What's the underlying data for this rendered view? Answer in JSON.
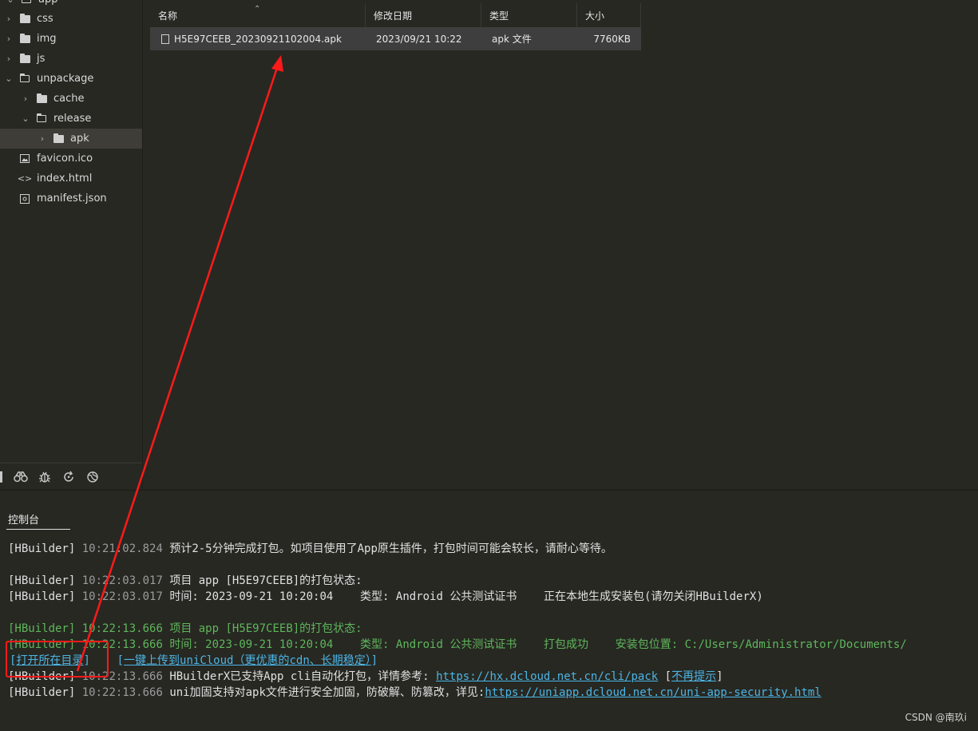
{
  "sidebar": {
    "items": [
      {
        "label": "app",
        "kind": "folder-open",
        "depth": 0
      },
      {
        "label": "css",
        "kind": "folder",
        "depth": 0
      },
      {
        "label": "img",
        "kind": "folder",
        "depth": 0
      },
      {
        "label": "js",
        "kind": "folder",
        "depth": 0
      },
      {
        "label": "unpackage",
        "kind": "folder-open",
        "depth": 0
      },
      {
        "label": "cache",
        "kind": "folder",
        "depth": 1
      },
      {
        "label": "release",
        "kind": "folder-open",
        "depth": 1
      },
      {
        "label": "apk",
        "kind": "folder",
        "depth": 2
      },
      {
        "label": "favicon.ico",
        "kind": "image-file",
        "depth": 0
      },
      {
        "label": "index.html",
        "kind": "code-file",
        "depth": 0
      },
      {
        "label": "manifest.json",
        "kind": "json-file",
        "depth": 0
      }
    ],
    "selected": "apk"
  },
  "explorer": {
    "columns": {
      "name": "名称",
      "date": "修改日期",
      "type": "类型",
      "size": "大小"
    },
    "file": {
      "name": "H5E97CEEB_20230921102004.apk",
      "date": "2023/09/21 10:22",
      "type": "apk 文件",
      "size": "7760KB"
    }
  },
  "toolbar_icons": [
    "binoculars-icon",
    "bug-icon",
    "refresh-icon",
    "globe-icon"
  ],
  "console": {
    "tab_label": "控制台",
    "lines": [
      {
        "tag": "[HBuilder]",
        "time": "10:21:02.824",
        "text": "预计2-5分钟完成打包。如项目使用了App原生插件，打包时间可能会较长，请耐心等待。"
      },
      {
        "tag": "[HBuilder]",
        "time": "10:22:03.017",
        "text": "项目 app [H5E97CEEB]的打包状态:"
      },
      {
        "tag": "[HBuilder]",
        "time": "10:22:03.017",
        "text": "时间: 2023-09-21 10:20:04    类型: Android 公共测试证书    正在本地生成安装包(请勿关闭HBuilderX)"
      },
      {
        "tag": "[HBuilder]",
        "time": "10:22:13.666",
        "text": "项目 app [H5E97CEEB]的打包状态:"
      },
      {
        "tag": "[HBuilder]",
        "time": "10:22:13.666",
        "text": "时间: 2023-09-21 10:20:04    类型: Android 公共测试证书    打包成功    安装包位置: C:/Users/Administrator/Documents/"
      },
      {
        "open_dir": "打开所在目录",
        "upload": "一键上传到uniCloud（更优惠的cdn、长期稳定）"
      },
      {
        "tag": "[HBuilder]",
        "time": "10:22:13.666",
        "text": "HBuilderX已支持App cli自动化打包，详情参考:",
        "link": "https://hx.dcloud.net.cn/cli/pack",
        "dismiss": "不再提示"
      },
      {
        "tag": "[HBuilder]",
        "time": "10:22:13.666",
        "text": "uni加固支持对apk文件进行安全加固，防破解、防篡改，详见:",
        "link": "https://uniapp.dcloud.net.cn/uni-app-security.html"
      }
    ]
  },
  "watermark": "CSDN @南玖i",
  "colors": {
    "background": "#272822",
    "success_green": "#5fb65c",
    "link_blue": "#4cb5e6",
    "annotation_red": "#ff1a1a"
  }
}
